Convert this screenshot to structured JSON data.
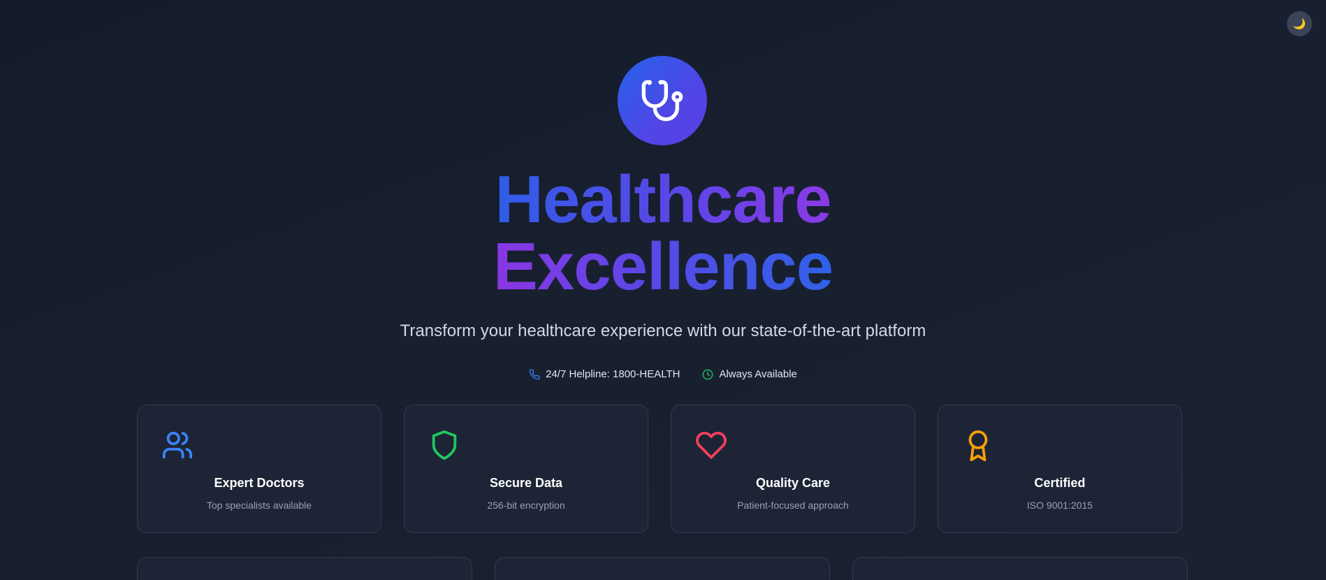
{
  "theme_toggle": {
    "icon": "moon-icon",
    "glyph": "🌙"
  },
  "hero": {
    "logo_icon": "stethoscope-icon",
    "title_line1": "Healthcare",
    "title_line2": "Excellence",
    "subtitle": "Transform your healthcare experience with our state-of-the-art platform"
  },
  "info": [
    {
      "icon": "phone-icon",
      "text": "24/7 Helpline: 1800-HEALTH"
    },
    {
      "icon": "clock-icon",
      "text": "Always Available"
    }
  ],
  "features": [
    {
      "icon": "users-icon",
      "color": "#3b82f6",
      "title": "Expert Doctors",
      "desc": "Top specialists available"
    },
    {
      "icon": "shield-icon",
      "color": "#22c55e",
      "title": "Secure Data",
      "desc": "256-bit encryption"
    },
    {
      "icon": "heart-icon",
      "color": "#f43f5e",
      "title": "Quality Care",
      "desc": "Patient-focused approach"
    },
    {
      "icon": "award-icon",
      "color": "#f59e0b",
      "title": "Certified",
      "desc": "ISO 9001:2015"
    }
  ],
  "colors": {
    "accent_blue": "#2563eb",
    "accent_purple": "#8b3ae6",
    "background": "#161d2d"
  }
}
